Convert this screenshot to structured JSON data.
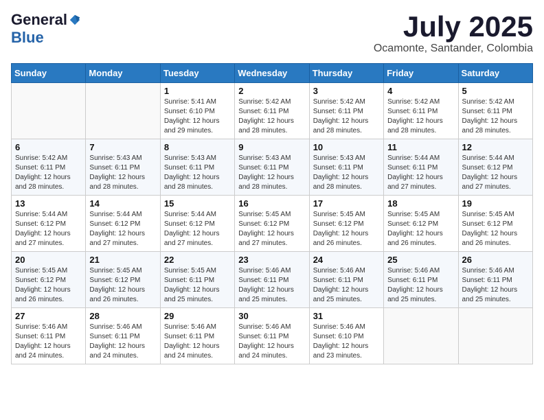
{
  "logo": {
    "general": "General",
    "blue": "Blue"
  },
  "title": "July 2025",
  "subtitle": "Ocamonte, Santander, Colombia",
  "days_of_week": [
    "Sunday",
    "Monday",
    "Tuesday",
    "Wednesday",
    "Thursday",
    "Friday",
    "Saturday"
  ],
  "weeks": [
    [
      {
        "day": "",
        "info": ""
      },
      {
        "day": "",
        "info": ""
      },
      {
        "day": "1",
        "info": "Sunrise: 5:41 AM\nSunset: 6:10 PM\nDaylight: 12 hours and 29 minutes."
      },
      {
        "day": "2",
        "info": "Sunrise: 5:42 AM\nSunset: 6:11 PM\nDaylight: 12 hours and 28 minutes."
      },
      {
        "day": "3",
        "info": "Sunrise: 5:42 AM\nSunset: 6:11 PM\nDaylight: 12 hours and 28 minutes."
      },
      {
        "day": "4",
        "info": "Sunrise: 5:42 AM\nSunset: 6:11 PM\nDaylight: 12 hours and 28 minutes."
      },
      {
        "day": "5",
        "info": "Sunrise: 5:42 AM\nSunset: 6:11 PM\nDaylight: 12 hours and 28 minutes."
      }
    ],
    [
      {
        "day": "6",
        "info": "Sunrise: 5:42 AM\nSunset: 6:11 PM\nDaylight: 12 hours and 28 minutes."
      },
      {
        "day": "7",
        "info": "Sunrise: 5:43 AM\nSunset: 6:11 PM\nDaylight: 12 hours and 28 minutes."
      },
      {
        "day": "8",
        "info": "Sunrise: 5:43 AM\nSunset: 6:11 PM\nDaylight: 12 hours and 28 minutes."
      },
      {
        "day": "9",
        "info": "Sunrise: 5:43 AM\nSunset: 6:11 PM\nDaylight: 12 hours and 28 minutes."
      },
      {
        "day": "10",
        "info": "Sunrise: 5:43 AM\nSunset: 6:11 PM\nDaylight: 12 hours and 28 minutes."
      },
      {
        "day": "11",
        "info": "Sunrise: 5:44 AM\nSunset: 6:11 PM\nDaylight: 12 hours and 27 minutes."
      },
      {
        "day": "12",
        "info": "Sunrise: 5:44 AM\nSunset: 6:12 PM\nDaylight: 12 hours and 27 minutes."
      }
    ],
    [
      {
        "day": "13",
        "info": "Sunrise: 5:44 AM\nSunset: 6:12 PM\nDaylight: 12 hours and 27 minutes."
      },
      {
        "day": "14",
        "info": "Sunrise: 5:44 AM\nSunset: 6:12 PM\nDaylight: 12 hours and 27 minutes."
      },
      {
        "day": "15",
        "info": "Sunrise: 5:44 AM\nSunset: 6:12 PM\nDaylight: 12 hours and 27 minutes."
      },
      {
        "day": "16",
        "info": "Sunrise: 5:45 AM\nSunset: 6:12 PM\nDaylight: 12 hours and 27 minutes."
      },
      {
        "day": "17",
        "info": "Sunrise: 5:45 AM\nSunset: 6:12 PM\nDaylight: 12 hours and 26 minutes."
      },
      {
        "day": "18",
        "info": "Sunrise: 5:45 AM\nSunset: 6:12 PM\nDaylight: 12 hours and 26 minutes."
      },
      {
        "day": "19",
        "info": "Sunrise: 5:45 AM\nSunset: 6:12 PM\nDaylight: 12 hours and 26 minutes."
      }
    ],
    [
      {
        "day": "20",
        "info": "Sunrise: 5:45 AM\nSunset: 6:12 PM\nDaylight: 12 hours and 26 minutes."
      },
      {
        "day": "21",
        "info": "Sunrise: 5:45 AM\nSunset: 6:12 PM\nDaylight: 12 hours and 26 minutes."
      },
      {
        "day": "22",
        "info": "Sunrise: 5:45 AM\nSunset: 6:11 PM\nDaylight: 12 hours and 25 minutes."
      },
      {
        "day": "23",
        "info": "Sunrise: 5:46 AM\nSunset: 6:11 PM\nDaylight: 12 hours and 25 minutes."
      },
      {
        "day": "24",
        "info": "Sunrise: 5:46 AM\nSunset: 6:11 PM\nDaylight: 12 hours and 25 minutes."
      },
      {
        "day": "25",
        "info": "Sunrise: 5:46 AM\nSunset: 6:11 PM\nDaylight: 12 hours and 25 minutes."
      },
      {
        "day": "26",
        "info": "Sunrise: 5:46 AM\nSunset: 6:11 PM\nDaylight: 12 hours and 25 minutes."
      }
    ],
    [
      {
        "day": "27",
        "info": "Sunrise: 5:46 AM\nSunset: 6:11 PM\nDaylight: 12 hours and 24 minutes."
      },
      {
        "day": "28",
        "info": "Sunrise: 5:46 AM\nSunset: 6:11 PM\nDaylight: 12 hours and 24 minutes."
      },
      {
        "day": "29",
        "info": "Sunrise: 5:46 AM\nSunset: 6:11 PM\nDaylight: 12 hours and 24 minutes."
      },
      {
        "day": "30",
        "info": "Sunrise: 5:46 AM\nSunset: 6:11 PM\nDaylight: 12 hours and 24 minutes."
      },
      {
        "day": "31",
        "info": "Sunrise: 5:46 AM\nSunset: 6:10 PM\nDaylight: 12 hours and 23 minutes."
      },
      {
        "day": "",
        "info": ""
      },
      {
        "day": "",
        "info": ""
      }
    ]
  ]
}
